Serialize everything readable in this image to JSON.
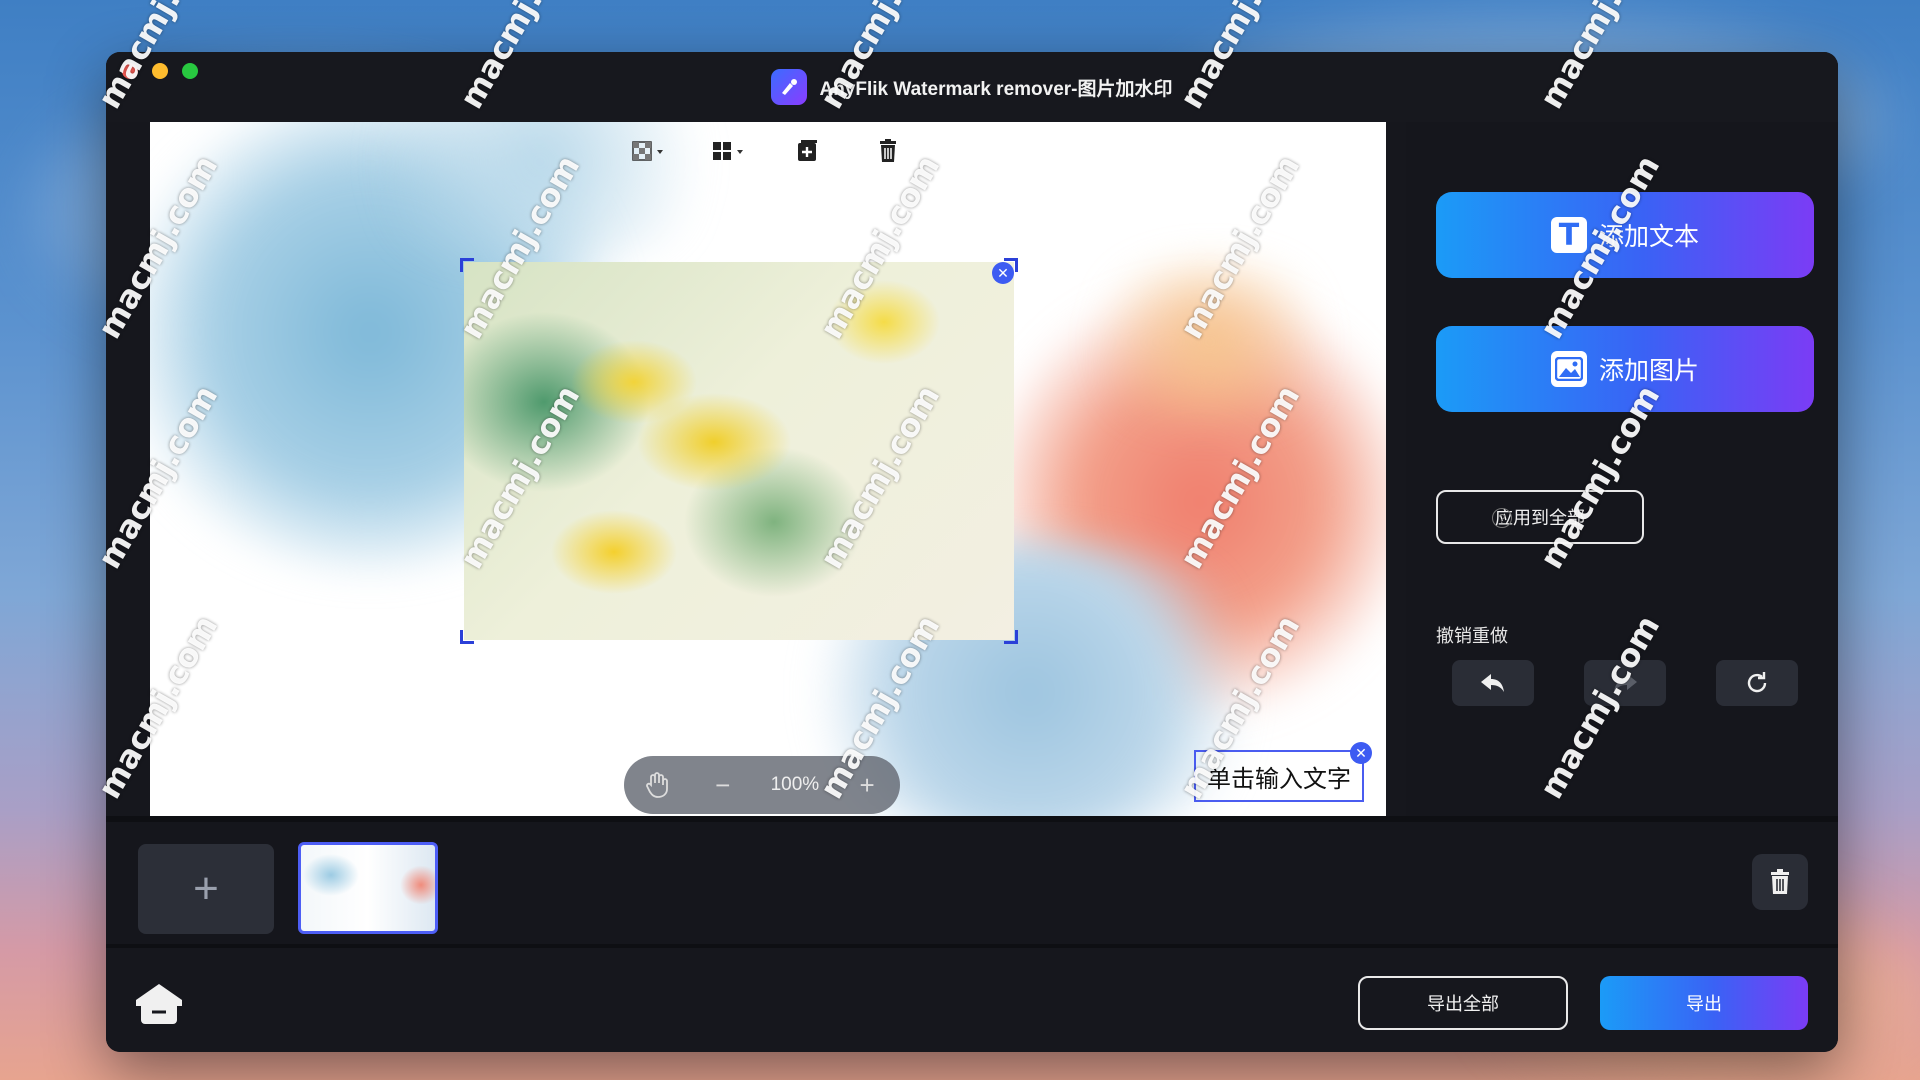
{
  "window": {
    "title": "AnyFlik Watermark remover-图片加水印"
  },
  "canvas_toolbar": {
    "icons": [
      "transparency-icon",
      "grid-layout-icon",
      "add-layer-icon",
      "trash-icon"
    ]
  },
  "text_watermark": {
    "value": "单击输入文字"
  },
  "zoom": {
    "level": "100%",
    "minus": "−",
    "plus": "+"
  },
  "right_panel": {
    "add_text_label": "添加文本",
    "add_image_label": "添加图片",
    "apply_all_label": "应用到全部",
    "help_symbol": "?",
    "undo_redo_title": "撤销重做"
  },
  "thumbnails": {
    "add_symbol": "+"
  },
  "bottom": {
    "export_all_label": "导出全部",
    "export_label": "导出"
  },
  "overlay_watermark": {
    "text": "macmj.com"
  },
  "colors": {
    "accent_start": "#1b9bf7",
    "accent_end": "#7b3cf5",
    "selection": "#3d5bf2",
    "window_bg": "#16171d"
  }
}
